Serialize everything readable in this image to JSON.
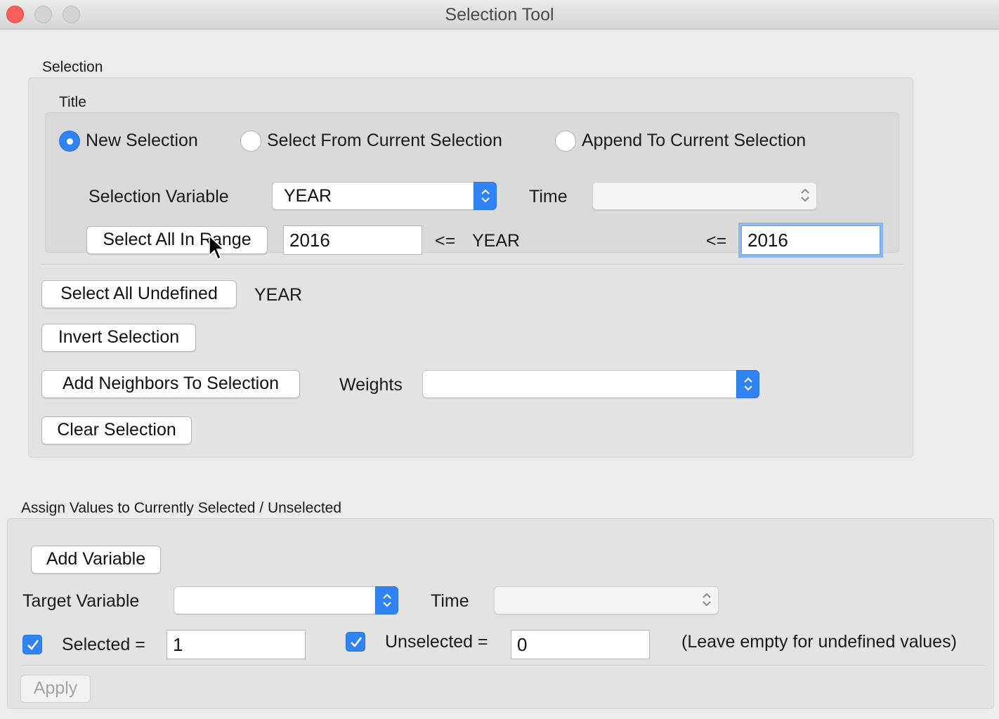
{
  "window": {
    "title": "Selection Tool"
  },
  "selection": {
    "header": "Selection",
    "title": "Title",
    "mode_options": [
      {
        "label": "New Selection",
        "checked": true
      },
      {
        "label": "Select From Current Selection",
        "checked": false
      },
      {
        "label": "Append To Current Selection",
        "checked": false
      }
    ],
    "variable_label": "Selection Variable",
    "variable_value": "YEAR",
    "time_label": "Time",
    "time_value": "",
    "range_button": "Select All In Range",
    "range_min": "2016",
    "range_op_left": "<=",
    "range_variable": "YEAR",
    "range_op_right": "<=",
    "range_max": "2016",
    "undefined_button": "Select All Undefined",
    "undefined_variable": "YEAR",
    "invert_button": "Invert Selection",
    "neighbors_button": "Add Neighbors To Selection",
    "weights_label": "Weights",
    "weights_value": "",
    "clear_button": "Clear Selection"
  },
  "assign": {
    "header": "Assign Values to Currently Selected / Unselected",
    "add_variable_button": "Add Variable",
    "target_label": "Target Variable",
    "target_value": "",
    "time_label": "Time",
    "time_value": "",
    "selected_checked": true,
    "selected_label": "Selected =",
    "selected_value": "1",
    "unselected_checked": true,
    "unselected_label": "Unselected =",
    "unselected_value": "0",
    "hint": "(Leave empty for undefined values)",
    "apply_button": "Apply"
  },
  "colors": {
    "accent": "#2f83f3",
    "close": "#fc5f57",
    "panel": "#e3e3e3",
    "background": "#ececec"
  }
}
